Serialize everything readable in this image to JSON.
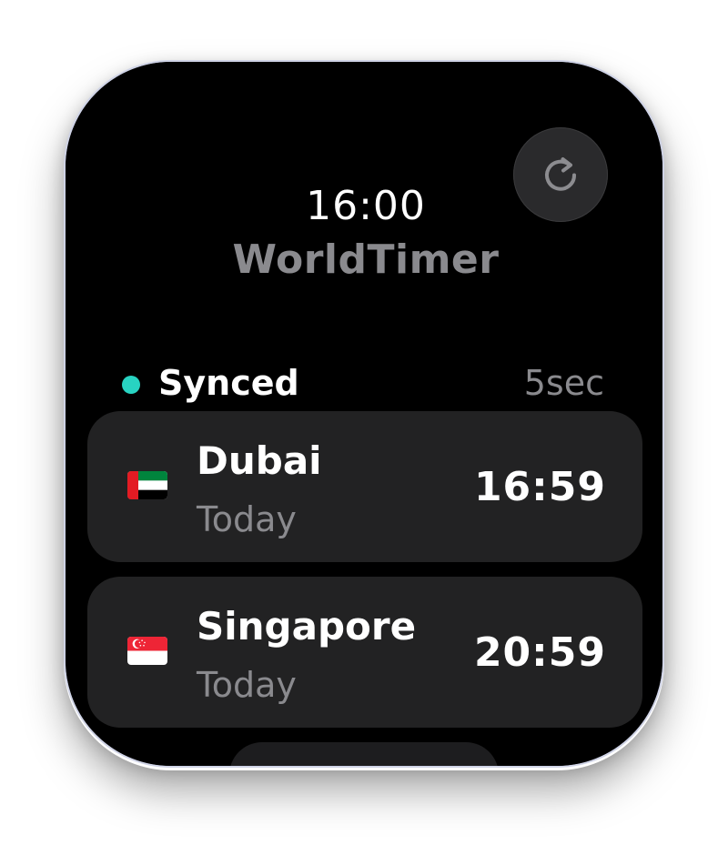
{
  "header": {
    "time": "16:00",
    "title": "WorldTimer",
    "refresh_icon": "refresh-icon"
  },
  "status": {
    "label": "Synced",
    "age": "5sec",
    "dot_color": "#28d3c2"
  },
  "cities": [
    {
      "name": "Dubai",
      "day": "Today",
      "time": "16:59",
      "flag_icon": "uae-flag-icon"
    },
    {
      "name": "Singapore",
      "day": "Today",
      "time": "20:59",
      "flag_icon": "singapore-flag-icon"
    }
  ],
  "colors": {
    "background": "#000000",
    "card": "#222223",
    "muted_text": "#8a8a8e",
    "accent": "#28d3c2"
  }
}
